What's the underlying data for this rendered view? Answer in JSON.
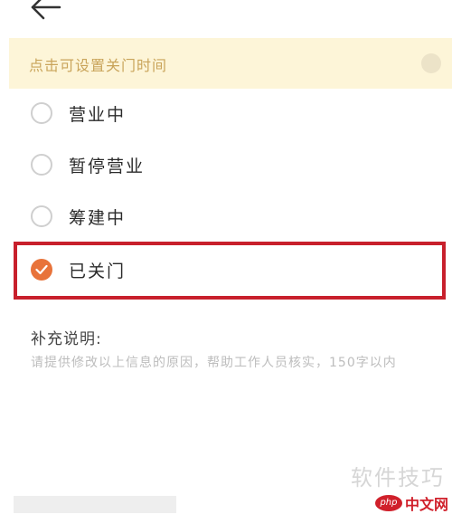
{
  "header": {
    "back_icon": "arrow-left-icon"
  },
  "banner": {
    "text": "点击可设置关门时间",
    "close_icon": "close-circle-icon"
  },
  "status_options": [
    {
      "label": "营业中",
      "checked": false
    },
    {
      "label": "暂停营业",
      "checked": false
    },
    {
      "label": "筹建中",
      "checked": false
    },
    {
      "label": "已关门",
      "checked": true
    }
  ],
  "supplement": {
    "title": "补充说明:",
    "placeholder": "请提供修改以上信息的原因，帮助工作人员核实，150字以内"
  },
  "watermark": {
    "site_text": "软件技巧",
    "php_logo": "php",
    "php_text": "中文网"
  },
  "colors": {
    "accent": "#e8733a",
    "highlight_border": "#c8202c",
    "banner_bg": "#fdf5d8"
  }
}
